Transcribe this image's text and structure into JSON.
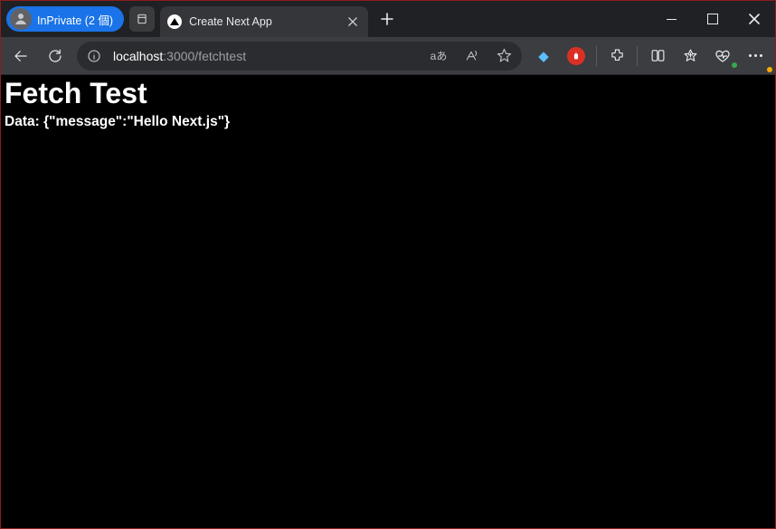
{
  "titlebar": {
    "inprivate_label": "InPrivate (2 個)",
    "tab_title": "Create Next App"
  },
  "toolbar": {
    "url_host": "localhost",
    "url_rest": ":3000/fetchtest",
    "reading_label": "aあ"
  },
  "icons": {
    "back": "back-icon",
    "refresh": "refresh-icon",
    "info": "site-info-icon",
    "translate": "translate-icon",
    "read_aloud": "read-aloud-icon",
    "favorite": "favorite-star-icon",
    "gem": "rewards-gem-icon",
    "shield": "tracking-shield-icon",
    "extension": "extension-puzzle-icon",
    "split": "split-screen-icon",
    "collections": "collections-icon",
    "performance": "performance-heart-icon",
    "more": "more-menu-icon",
    "tabactions": "tab-actions-icon",
    "close": "close-icon",
    "newtab": "plus-icon",
    "min": "window-minimize-icon",
    "max": "window-maximize-icon",
    "closewin": "window-close-icon"
  },
  "page": {
    "heading": "Fetch Test",
    "data_prefix": "Data: ",
    "data_json": "{\"message\":\"Hello Next.js\"}"
  }
}
